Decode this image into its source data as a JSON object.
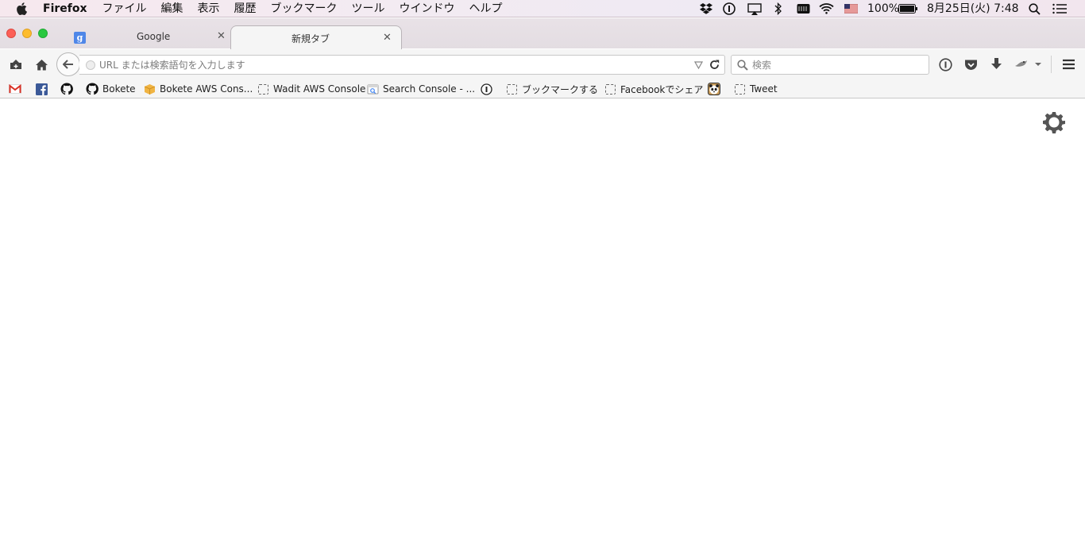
{
  "menubar": {
    "app_name": "Firefox",
    "items": [
      "ファイル",
      "編集",
      "表示",
      "履歴",
      "ブックマーク",
      "ツール",
      "ウインドウ",
      "ヘルプ"
    ],
    "status": {
      "battery_percent": "100%",
      "datetime": "8月25日(火) 7:48",
      "icons": [
        "dropbox-icon",
        "1password-icon",
        "airplay-icon",
        "bluetooth-icon",
        "keyboard-icon",
        "wifi-icon",
        "us-flag-icon",
        "battery-icon",
        "spotlight-icon",
        "notification-center-icon"
      ]
    }
  },
  "tabs": [
    {
      "title": "Google",
      "active": false,
      "favicon": "g"
    },
    {
      "title": "新規タブ",
      "active": true
    }
  ],
  "navbar": {
    "url_placeholder": "URL または検索語句を入力します",
    "url_value": "",
    "search_placeholder": "検索",
    "search_value": ""
  },
  "bookmarks": [
    {
      "label": "",
      "icon": "gmail-icon"
    },
    {
      "label": "",
      "icon": "facebook-icon"
    },
    {
      "label": "",
      "icon": "github-icon"
    },
    {
      "label": "Bokete",
      "icon": "github-icon"
    },
    {
      "label": "Bokete AWS Cons...",
      "icon": "aws-cube-icon"
    },
    {
      "label": "Wadit AWS Console",
      "icon": "dashed-page-icon"
    },
    {
      "label": "Search Console - ...",
      "icon": "search-console-icon"
    },
    {
      "label": "",
      "icon": "1password-icon"
    },
    {
      "label": "ブックマークする",
      "icon": "dashed-page-icon"
    },
    {
      "label": "Facebookでシェア",
      "icon": "dashed-page-icon"
    },
    {
      "label": "",
      "icon": "panda-icon"
    },
    {
      "label": "Tweet",
      "icon": "dashed-page-icon"
    }
  ],
  "colors": {
    "close": "#fc5f57",
    "minimize": "#fdbc2e",
    "maximize": "#29c840",
    "google_favicon": "#4f87e8",
    "facebook": "#3b5998",
    "gmail_red": "#d93025"
  }
}
